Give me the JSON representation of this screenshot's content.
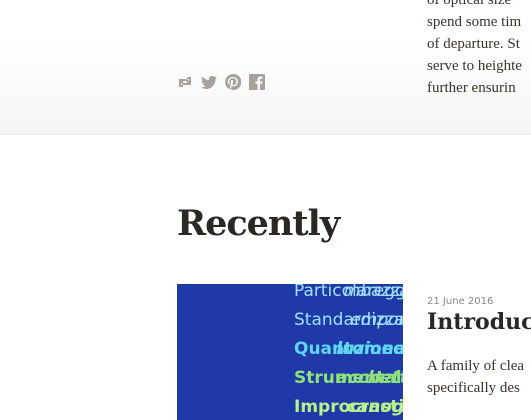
{
  "previous_post": {
    "excerpt_lines": [
      "of optical size",
      "spend some tim",
      "of departure. St",
      "serve to heighte",
      "further ensurin"
    ],
    "share_icons": [
      "link-icon",
      "twitter-icon",
      "pinterest-icon",
      "facebook-icon"
    ]
  },
  "recently": {
    "heading": "Recently",
    "card": {
      "image_words": [
        {
          "left": "mbazzamenti",
          "right": "Particolaregg",
          "color": "#9fe0f4"
        },
        {
          "left": "emporaneità",
          "right": "Standardizza",
          "color": "#9fe0f4"
        },
        {
          "left": "luzionarismo",
          "right": "Quantomec",
          "color": "#5fd6ee"
        },
        {
          "left": "acchettatore",
          "right": "Strumentali",
          "color": "#8fe07a"
        },
        {
          "left": "canografica",
          "right": "Improcrasti",
          "color": "#b8f08a"
        }
      ],
      "date": "21 June 2016",
      "title": "Introduc",
      "summary_lines": [
        "A family of clea",
        "specifically des"
      ]
    }
  }
}
